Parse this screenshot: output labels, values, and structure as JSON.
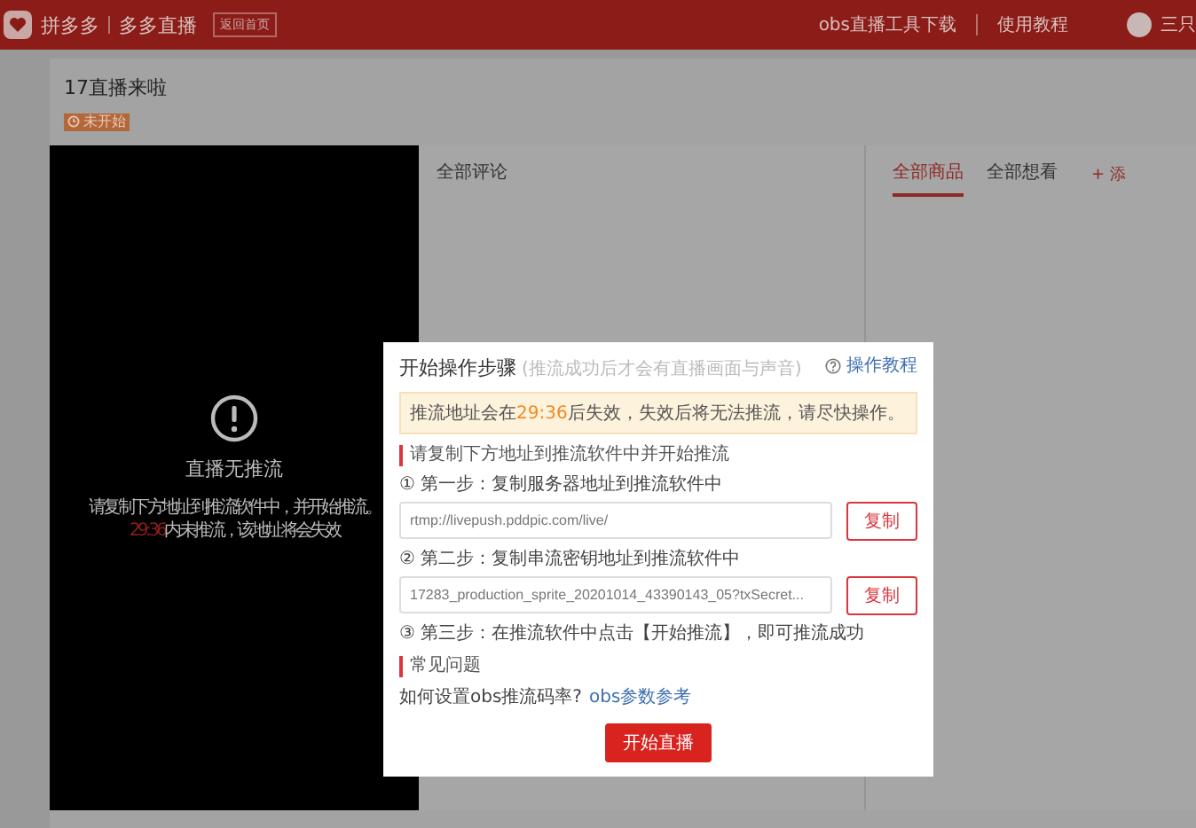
{
  "header": {
    "brand": "拼多多",
    "section": "多多直播",
    "back_button": "返回首页",
    "links": [
      "obs直播工具下载",
      "使用教程"
    ],
    "user": "三只"
  },
  "room": {
    "title": "17直播来啦",
    "status": "未开始"
  },
  "video": {
    "title": "直播无推流",
    "message": "请复制下方地址到推流软件中，并开始推流。",
    "countdown": "29:36",
    "message_tail": "内未推流，该地址将会失效"
  },
  "comments": {
    "title": "全部评论"
  },
  "products": {
    "tabs": [
      {
        "label": "全部商品",
        "selected": true
      },
      {
        "label": "全部想看",
        "selected": false
      }
    ],
    "add": "+ 添"
  },
  "modal": {
    "title": "开始操作步骤",
    "subtitle": "(推流成功后才会有直播画面与声音)",
    "help_link": "操作教程",
    "notice": {
      "before": "推流地址会在",
      "time": "29:36",
      "after": "后失效，失效后将无法推流，请尽快操作。"
    },
    "section_heading": "请复制下方地址到推流软件中并开始推流",
    "steps": [
      {
        "label": "① 第一步：复制服务器地址到推流软件中",
        "value": "rtmp://livepush.pddpic.com/live/",
        "button": "复制"
      },
      {
        "label": "② 第二步：复制串流密钥地址到推流软件中",
        "value": "17283_production_sprite_20201014_43390143_05?txSecret...",
        "button": "复制"
      },
      {
        "label": "③ 第三步：在推流软件中点击【开始推流】，即可推流成功"
      }
    ],
    "faq_heading": "常见问题",
    "faq": {
      "question": "如何设置obs推流码率?",
      "link": "obs参数参考"
    },
    "start_button": "开始直播"
  }
}
